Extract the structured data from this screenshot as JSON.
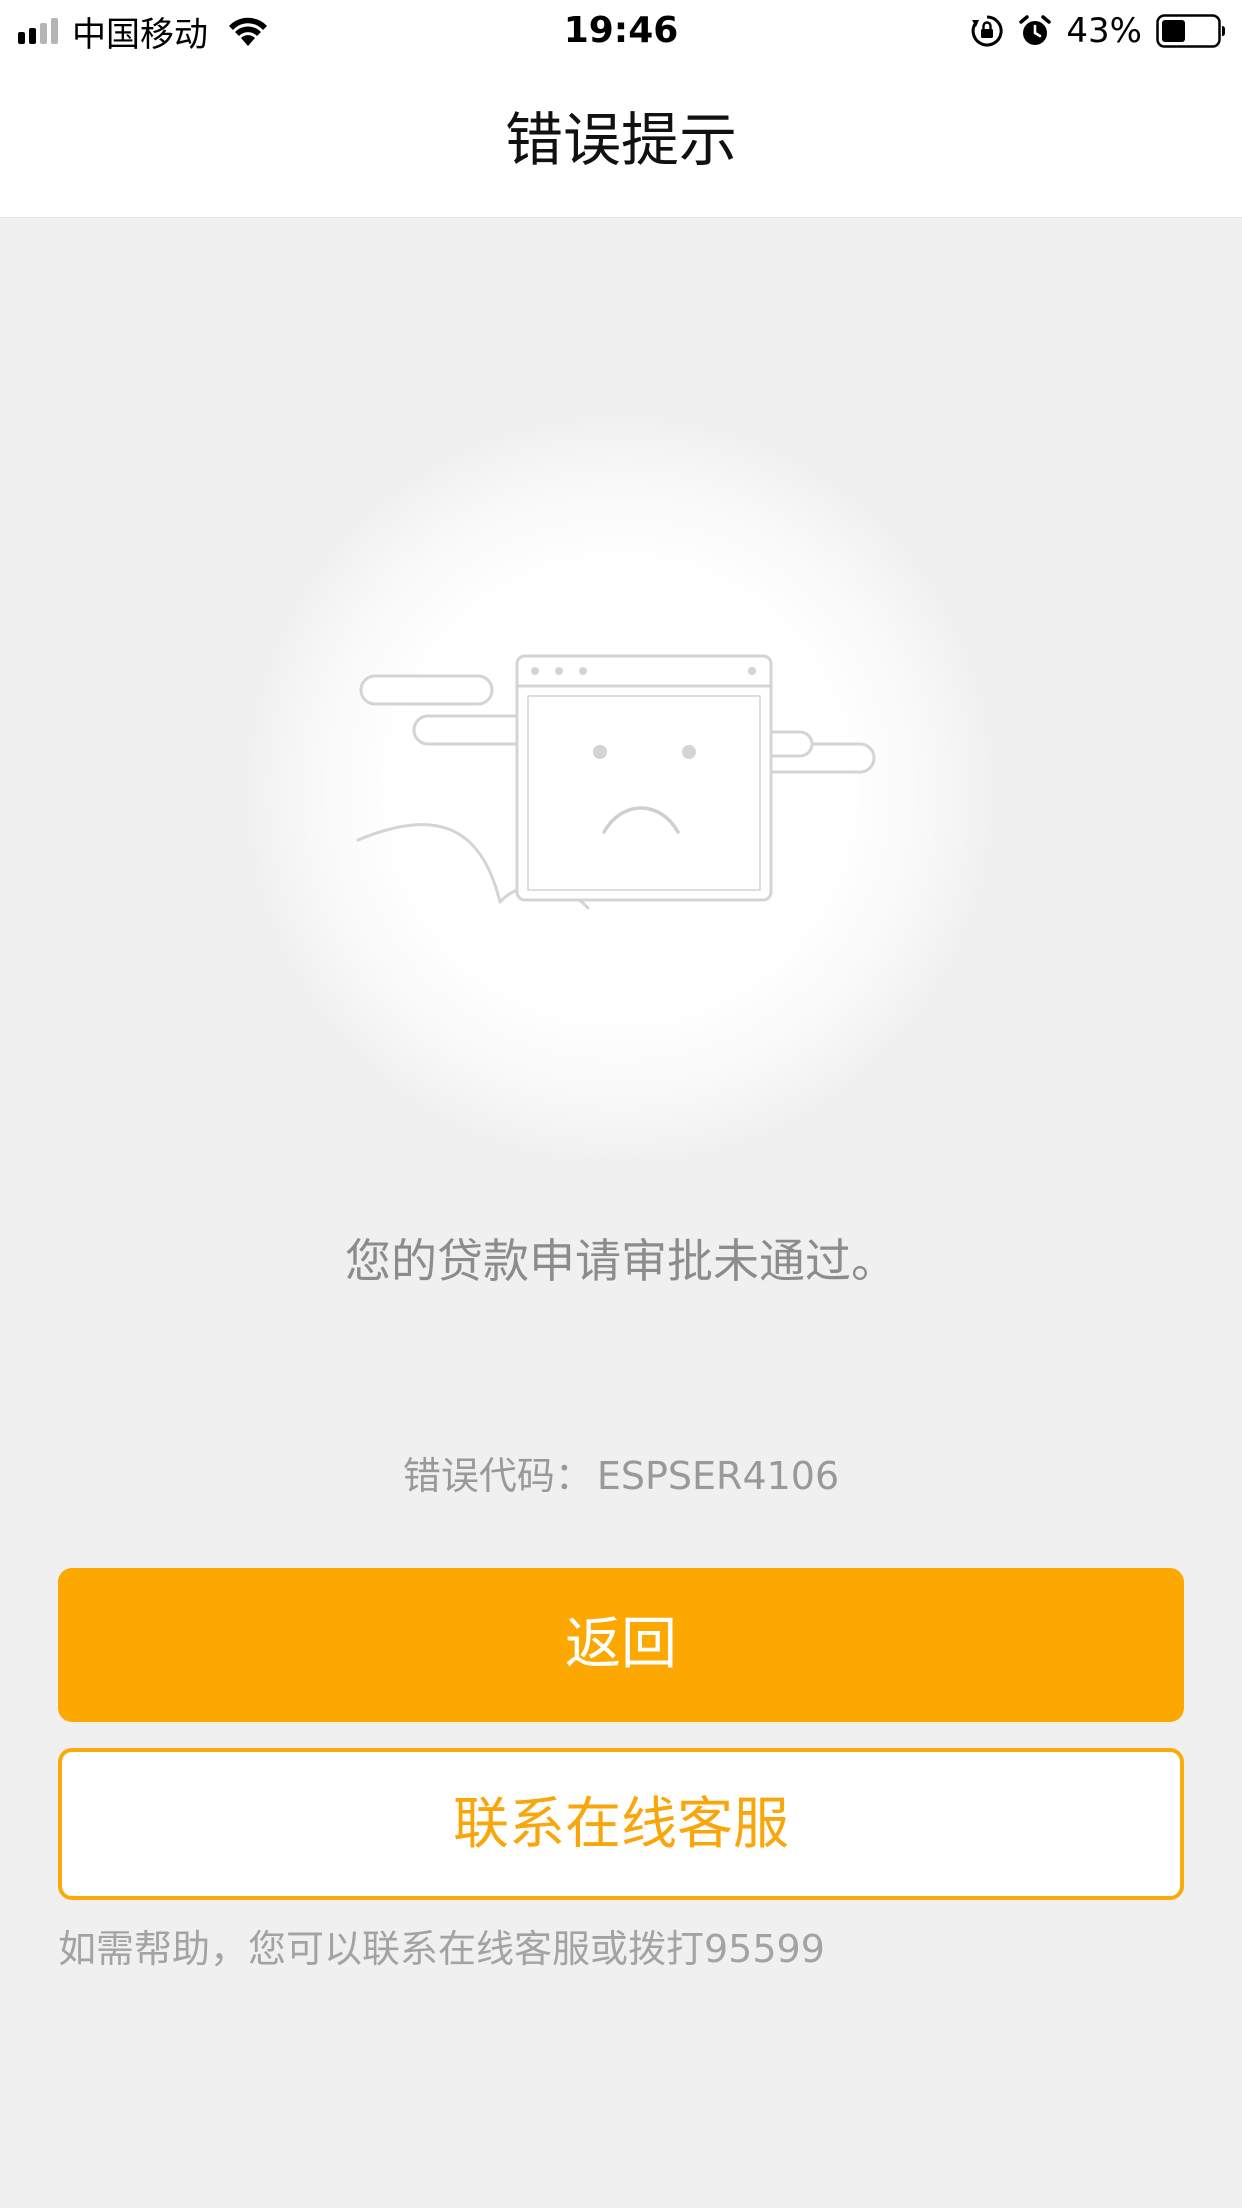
{
  "status_bar": {
    "carrier": "中国移动",
    "time": "19:46",
    "battery_percent": "43%",
    "battery_level": 0.43,
    "icons": [
      "signal-icon",
      "wifi-icon",
      "rotation-lock-icon",
      "alarm-icon",
      "battery-icon"
    ]
  },
  "nav": {
    "title": "错误提示"
  },
  "main": {
    "illustration": "sad-browser-window-icon",
    "message": "您的贷款申请审批未通过。",
    "error_code_label": "错误代码：",
    "error_code_value": "ESPSER4106"
  },
  "buttons": {
    "back_label": "返回",
    "service_label": "联系在线客服"
  },
  "help_text": "如需帮助，您可以联系在线客服或拨打95599",
  "colors": {
    "accent": "#fca800",
    "background": "#f0f0f0",
    "text_muted": "#8c8c8c"
  }
}
